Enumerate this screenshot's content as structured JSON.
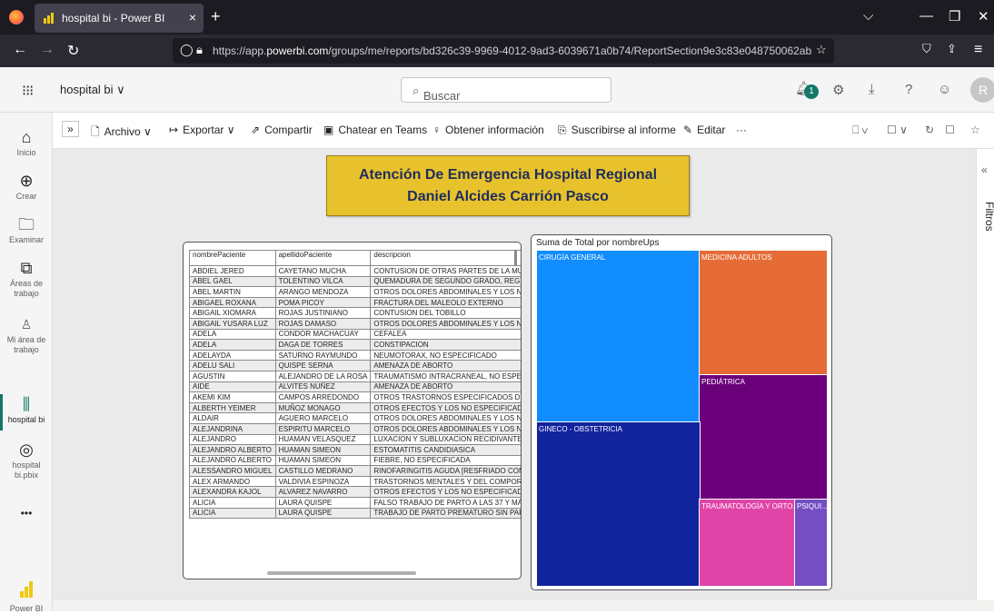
{
  "browser": {
    "tab_title": "hospital bi - Power BI",
    "tab_close": "×",
    "new_tab": "+",
    "url_prefix": "https://app.",
    "url_domain": "powerbi.com",
    "url_path": "/groups/me/reports/bd326c39-9969-4012-9ad3-6039671a0b74/ReportSection9e3c83e048750062ab2d?e",
    "icons": [
      "firefox-logo",
      "back-icon",
      "forward-icon",
      "reload-icon",
      "shield-icon",
      "lock-icon",
      "bookmark-star-icon",
      "pocket-icon",
      "share-icon",
      "menu-icon",
      "chevron-down-icon",
      "minimize-icon",
      "restore-icon",
      "close-icon"
    ]
  },
  "header": {
    "app_title": "hospital bi ∨",
    "search_placeholder": "Buscar",
    "notification_count": "1",
    "avatar_initial": "R"
  },
  "leftnav": {
    "items": [
      {
        "label": "Inicio",
        "icon": "home-icon"
      },
      {
        "label": "Crear",
        "icon": "plus-circle-icon"
      },
      {
        "label": "Examinar",
        "icon": "folder-icon"
      },
      {
        "label": "Áreas de trabajo",
        "icon": "workspaces-icon"
      },
      {
        "label": "Mi área de trabajo",
        "icon": "person-icon"
      },
      {
        "label": "hospital bi",
        "icon": "report-icon"
      },
      {
        "label": "hospital bi.pbix",
        "icon": "gauge-icon"
      },
      {
        "label": "•••",
        "icon": "more-icon"
      }
    ],
    "footer": "Power BI"
  },
  "actionbar": {
    "expand": "»",
    "archivo": "Archivo ∨",
    "exportar": "Exportar ∨",
    "compartir": "Compartir",
    "chatear": "Chatear en Teams",
    "obtener": "Obtener información",
    "suscribirse": "Suscribirse al informe",
    "editar": "Editar",
    "more": "···"
  },
  "filters": {
    "label": "Filtros",
    "collapse": "«"
  },
  "report": {
    "title_line1": "Atención De Emergencia Hospital Regional",
    "title_line2": "Daniel Alcides Carrión Pasco",
    "table": {
      "headers": [
        "nombrePaciente",
        "apellidoPaciente",
        "descripcion"
      ],
      "rows": [
        [
          "ABDIEL JERED",
          "CAYETANO MUCHA",
          "CONTUSION DE OTRAS PARTES DE LA MUÑECA Y"
        ],
        [
          "ABEL GAEL",
          "TOLENTINO VILCA",
          "QUEMADURA DE SEGUNDO GRADO, REGION DEL"
        ],
        [
          "ABEL MARTIN",
          "ARANGO MENDOZA",
          "OTROS DOLORES ABDOMINALES Y LOS NO ESPEC"
        ],
        [
          "ABIGAEL ROXANA",
          "POMA PICOY",
          "FRACTURA DEL MALEOLO EXTERNO"
        ],
        [
          "ABIGAIL XIOMARA",
          "ROJAS JUSTINIANO",
          "CONTUSION DEL TOBILLO"
        ],
        [
          "ABIGAIL YUSARA LUZ",
          "ROJAS DAMASO",
          "OTROS DOLORES ABDOMINALES Y LOS NO ESPEC"
        ],
        [
          "ADELA",
          "CONDOR MACHACUAY",
          "CEFALEA"
        ],
        [
          "ADELA",
          "DAGA DE TORRES",
          "CONSTIPACION"
        ],
        [
          "ADELAYDA",
          "SATURNO RAYMUNDO",
          "NEUMOTORAX, NO ESPECIFICADO"
        ],
        [
          "ADELU SALI",
          "QUISPE SERNA",
          "AMENAZA DE ABORTO"
        ],
        [
          "AGUSTIN",
          "ALEJANDRO DE LA ROSA",
          "TRAUMATISMO INTRACRANEAL, NO ESPECIFICADO"
        ],
        [
          "AIDE",
          "ALVITES NUÑEZ",
          "AMENAZA DE ABORTO"
        ],
        [
          "AKEMI KIM",
          "CAMPOS ARREDONDO",
          "OTROS TRASTORNOS ESPECIFICADOS DEL CARTIL"
        ],
        [
          "ALBERTH YEIMER",
          "MUÑOZ MONAGO",
          "OTROS EFECTOS Y LOS NO ESPECIFICADOS DE LA"
        ],
        [
          "ALDAIR",
          "AGUERO MARCELO",
          "OTROS DOLORES ABDOMINALES Y LOS NO ESPEC"
        ],
        [
          "ALEJANDRINA",
          "ESPIRITU MARCELO",
          "OTROS DOLORES ABDOMINALES Y LOS NO ESPEC"
        ],
        [
          "ALEJANDRO",
          "HUAMAN VELASQUEZ",
          "LUXACION Y SUBLUXACION RECIDIVANTE DE LA A"
        ],
        [
          "ALEJANDRO ALBERTO",
          "HUAMAN SIMEON",
          "ESTOMATITIS CANDIDIASICA"
        ],
        [
          "ALEJANDRO ALBERTO",
          "HUAMAN SIMEON",
          "FIEBRE, NO ESPECIFICADA"
        ],
        [
          "ALESSANDRO MIGUEL",
          "CASTILLO MEDRANO",
          "RINOFARINGITIS AGUDA [RESFRIADO COMUN]"
        ],
        [
          "ALEX ARMANDO",
          "VALDIVIA ESPINOZA",
          "TRASTORNOS MENTALES Y DEL COMPORTAMIENT AGUDA"
        ],
        [
          "ALEXANDRA KAJOL",
          "ALVAREZ NAVARRO",
          "OTROS EFECTOS Y LOS NO ESPECIFICADOS DE LA"
        ],
        [
          "ALICIA",
          "LAURA QUISPE",
          "FALSO TRABAJO DE PARTO A LAS 37 Y MAS SEMA"
        ],
        [
          "ALICIA",
          "LAURA QUISPE",
          "TRABAJO DE PARTO PREMATURO SIN PARTO"
        ]
      ]
    },
    "treemap": {
      "title": "Suma de Total por nombreUps",
      "cells": [
        {
          "label": "CIRUGÍA GENERAL",
          "color": "#118dff"
        },
        {
          "label": "MEDICINA ADULTOS",
          "color": "#e66c37"
        },
        {
          "label": "PEDIÁTRICA",
          "color": "#6b007b"
        },
        {
          "label": "GINECO - OBSTETRICIA",
          "color": "#12239e"
        },
        {
          "label": "TRAUMATOLOGÍA Y ORTO...",
          "color": "#e044a7"
        },
        {
          "label": "PSIQUI...",
          "color": "#744ec2"
        }
      ]
    }
  }
}
